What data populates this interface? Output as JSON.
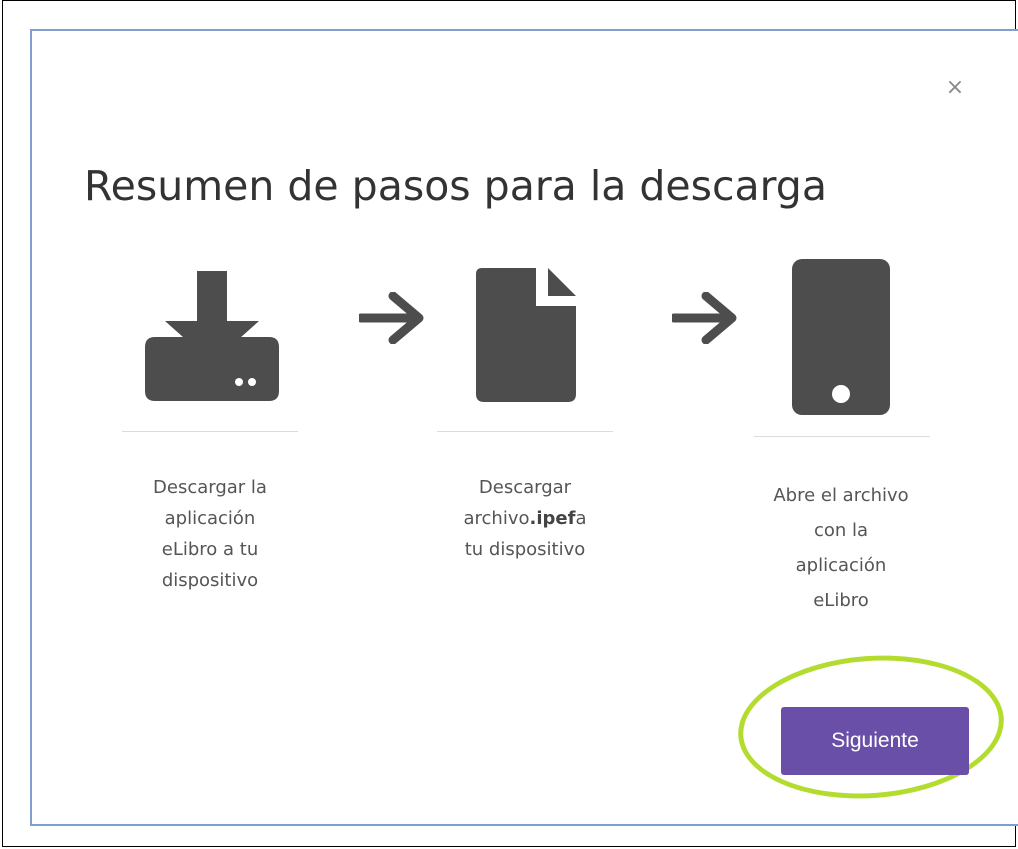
{
  "modal": {
    "close_glyph": "×",
    "title": "Resumen de pasos para la descarga"
  },
  "steps": [
    {
      "icon": "download-icon",
      "lines": [
        "Descargar la",
        "aplicación",
        "eLibro a tu",
        "dispositivo"
      ]
    },
    {
      "icon": "file-icon",
      "line1": "Descargar",
      "line2_prefix": "archivo",
      "line2_bold": ".ipef",
      "line2_suffix": "a",
      "line3": "tu dispositivo"
    },
    {
      "icon": "smartphone-icon",
      "lines": [
        "Abre el archivo",
        "con la",
        "aplicación",
        "eLibro"
      ]
    }
  ],
  "arrows": [
    "arrow-right-icon",
    "arrow-right-icon"
  ],
  "footer": {
    "next_label": "Siguiente",
    "highlight_color": "#b3dc2e",
    "button_color": "#6a4fa8"
  },
  "colors": {
    "icon": "#4d4d4d",
    "modal_border": "#7f9fce"
  }
}
